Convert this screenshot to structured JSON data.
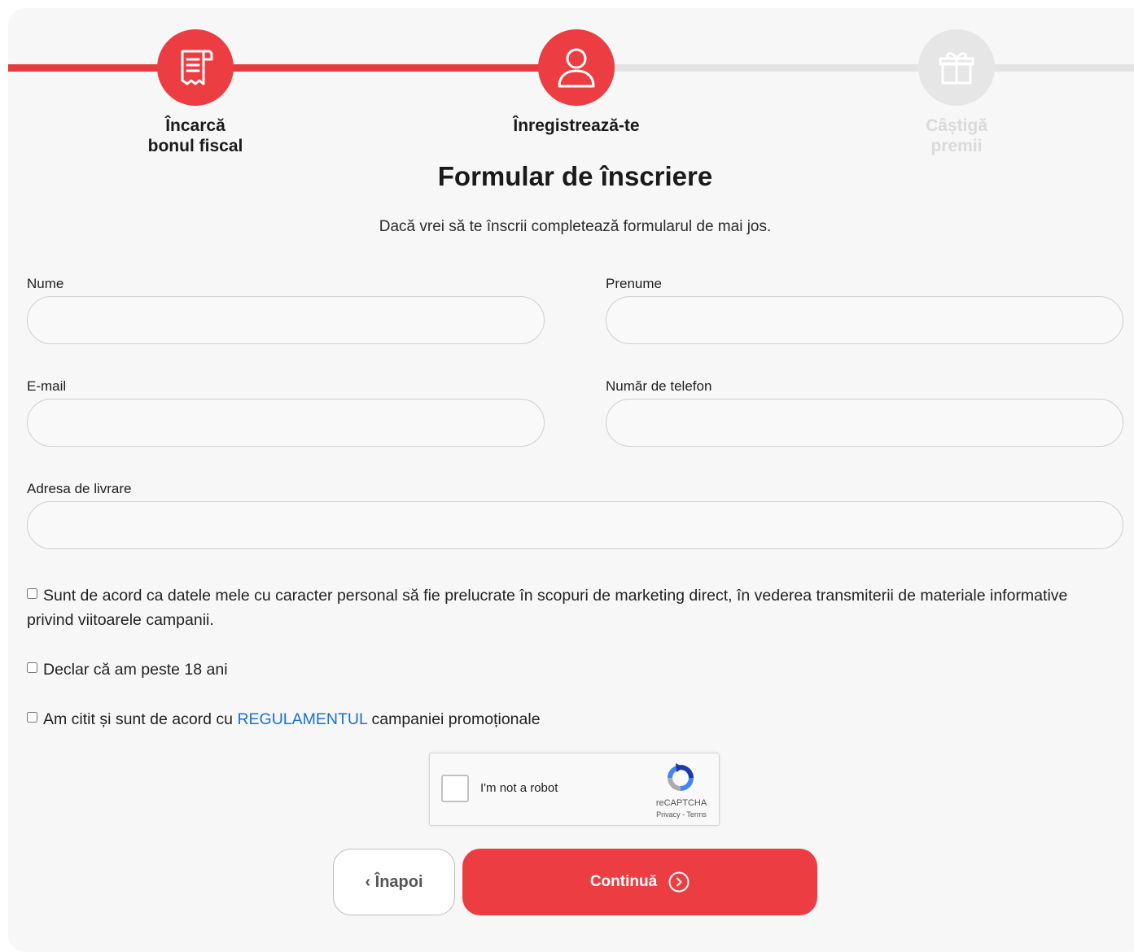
{
  "stepper": {
    "steps": [
      {
        "label_line1": "Încarcă",
        "label_line2": "bonul fiscal",
        "icon": "receipt-icon",
        "state": "completed"
      },
      {
        "label_line1": "Înregistrează-te",
        "label_line2": "",
        "icon": "user-icon",
        "state": "active"
      },
      {
        "label_line1": "Câștigă",
        "label_line2": "premii",
        "icon": "gift-icon",
        "state": "inactive"
      }
    ]
  },
  "form": {
    "title": "Formular de înscriere",
    "subtitle": "Dacă vrei să te înscrii completează formularul de mai jos.",
    "fields": {
      "nume": {
        "label": "Nume",
        "value": ""
      },
      "prenume": {
        "label": "Prenume",
        "value": ""
      },
      "email": {
        "label": "E-mail",
        "value": ""
      },
      "telefon": {
        "label": "Număr de telefon",
        "value": ""
      },
      "adresa": {
        "label": "Adresa de livrare",
        "value": ""
      }
    },
    "consents": {
      "marketing": "Sunt de acord ca datele mele cu caracter personal să fie prelucrate în scopuri de marketing direct, în vederea transmiterii de materiale informative privind viitoarele campanii.",
      "age": "Declar că am peste 18 ani",
      "rules_prefix": "Am citit și sunt de acord cu",
      "rules_link": "REGULAMENTUL",
      "rules_suffix": "campaniei promoționale"
    },
    "recaptcha": {
      "label": "I'm not a robot",
      "brand": "reCAPTCHA",
      "links": "Privacy - Terms"
    },
    "buttons": {
      "back": "‹ Înapoi",
      "next": "Continuă"
    }
  },
  "colors": {
    "accent": "#ec3d42",
    "inactive": "#e6e6e6",
    "link": "#1a6fd6"
  }
}
